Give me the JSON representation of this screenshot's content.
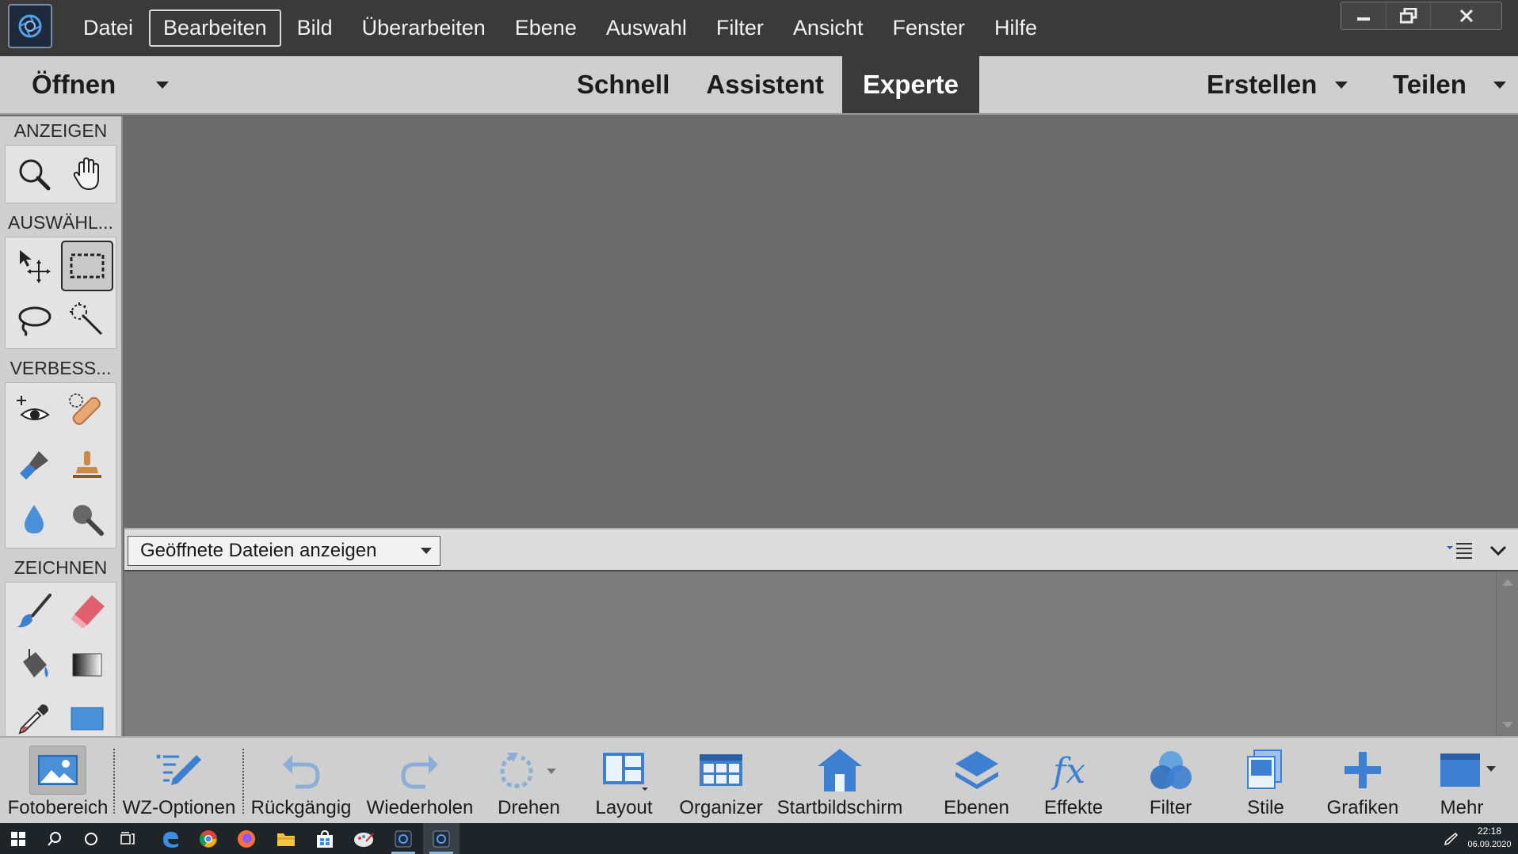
{
  "app": {
    "title": "Adobe Photoshop Elements",
    "accent": "#3a3a3a"
  },
  "menu": {
    "items": [
      {
        "label": "Datei",
        "active": false
      },
      {
        "label": "Bearbeiten",
        "active": true
      },
      {
        "label": "Bild",
        "active": false
      },
      {
        "label": "Überarbeiten",
        "active": false
      },
      {
        "label": "Ebene",
        "active": false
      },
      {
        "label": "Auswahl",
        "active": false
      },
      {
        "label": "Filter",
        "active": false
      },
      {
        "label": "Ansicht",
        "active": false
      },
      {
        "label": "Fenster",
        "active": false
      },
      {
        "label": "Hilfe",
        "active": false
      }
    ]
  },
  "modebar": {
    "open_label": "Öffnen",
    "tabs": [
      {
        "label": "Schnell",
        "active": false
      },
      {
        "label": "Assistent",
        "active": false
      },
      {
        "label": "Experte",
        "active": true
      }
    ],
    "create_label": "Erstellen",
    "share_label": "Teilen"
  },
  "toolbox": {
    "sections": [
      {
        "label": "ANZEIGEN",
        "tools": [
          "zoom-icon",
          "hand-icon"
        ]
      },
      {
        "label": "AUSWÄHL...",
        "tools": [
          "move-icon",
          "rectangular-marquee-icon",
          "lasso-icon",
          "quick-selection-icon"
        ]
      },
      {
        "label": "VERBESS...",
        "tools": [
          "red-eye-icon",
          "spot-healing-icon",
          "smart-brush-icon",
          "clone-stamp-icon",
          "blur-icon",
          "sponge-icon"
        ]
      },
      {
        "label": "ZEICHNEN",
        "tools": [
          "brush-icon",
          "eraser-icon",
          "paint-bucket-icon",
          "gradient-icon",
          "eyedropper-icon",
          "rectangle-shape-icon"
        ]
      }
    ],
    "active_tool": "rectangular-marquee-icon"
  },
  "photobin": {
    "select_value": "Geöffnete Dateien anzeigen"
  },
  "bottombar": {
    "buttons": [
      {
        "label": "Fotobereich",
        "icon": "photo-bin-icon"
      },
      {
        "label": "WZ-Optionen",
        "icon": "tool-options-icon"
      },
      {
        "label": "Rückgängig",
        "icon": "undo-icon"
      },
      {
        "label": "Wiederholen",
        "icon": "redo-icon"
      },
      {
        "label": "Drehen",
        "icon": "rotate-icon"
      },
      {
        "label": "Layout",
        "icon": "layout-icon"
      },
      {
        "label": "Organizer",
        "icon": "organizer-icon"
      },
      {
        "label": "Startbildschirm",
        "icon": "home-screen-icon"
      },
      {
        "label": "Ebenen",
        "icon": "layers-icon"
      },
      {
        "label": "Effekte",
        "icon": "effects-icon"
      },
      {
        "label": "Filter",
        "icon": "filter-icon"
      },
      {
        "label": "Stile",
        "icon": "styles-icon"
      },
      {
        "label": "Grafiken",
        "icon": "graphics-icon"
      },
      {
        "label": "Mehr",
        "icon": "more-icon"
      }
    ]
  },
  "taskbar": {
    "apps": [
      "windows-start-icon",
      "search-icon",
      "cortana-icon",
      "task-view-icon",
      "edge-icon",
      "chrome-icon",
      "firefox-icon",
      "file-explorer-icon",
      "store-icon",
      "paint-icon",
      "elements-app-icon",
      "elements-editor-icon"
    ],
    "time": "22:18",
    "date": "06.09.2020"
  }
}
